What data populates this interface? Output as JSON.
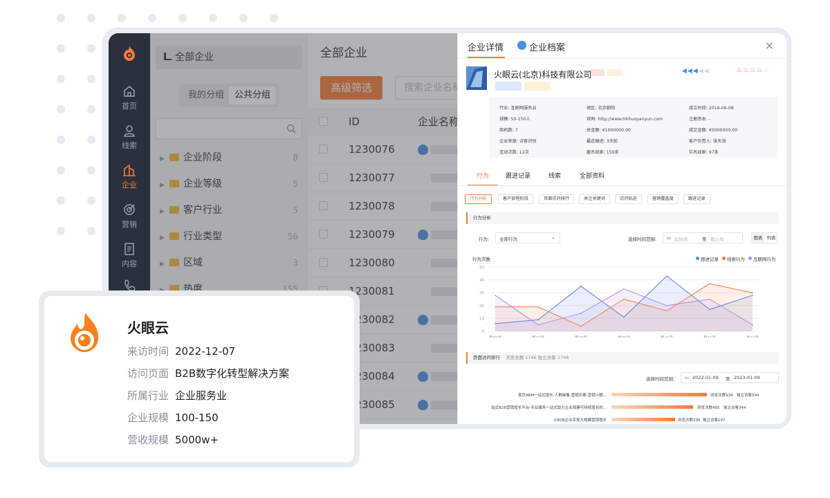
{
  "colors": {
    "accent": "#f37b3c",
    "rail": "#2b313c",
    "blue": "#5b7ee0",
    "purple": "#b08be8"
  },
  "rail": {
    "items": [
      {
        "label": "首页",
        "icon": "home-icon"
      },
      {
        "label": "线索",
        "icon": "user-icon"
      },
      {
        "label": "企业",
        "icon": "building-icon",
        "active": true
      },
      {
        "label": "营销",
        "icon": "target-icon"
      },
      {
        "label": "内容",
        "icon": "document-icon"
      },
      {
        "label": "",
        "icon": "phone-icon"
      }
    ]
  },
  "tree": {
    "header": "全部企业",
    "tabs": [
      "我的分组",
      "公共分组"
    ],
    "active_tab": "公共分组",
    "items": [
      {
        "label": "企业阶段",
        "count": "8"
      },
      {
        "label": "企业等级",
        "count": "5"
      },
      {
        "label": "客户行业",
        "count": "5"
      },
      {
        "label": "行业类型",
        "count": "56"
      },
      {
        "label": "区域",
        "count": "3"
      },
      {
        "label": "热度",
        "count": "155"
      }
    ]
  },
  "list": {
    "title": "全部企业",
    "filter_button": "高级筛选",
    "search_placeholder": "搜索企业名称",
    "columns": [
      "ID",
      "企业名称"
    ],
    "rows": [
      {
        "id": "1230076",
        "badge": true
      },
      {
        "id": "1230077",
        "badge": false
      },
      {
        "id": "1230078",
        "badge": false
      },
      {
        "id": "1230079",
        "badge": true
      },
      {
        "id": "1230080",
        "badge": false
      },
      {
        "id": "1230081",
        "badge": false
      },
      {
        "id": "1230082",
        "badge": true
      },
      {
        "id": "1230083",
        "badge": false
      },
      {
        "id": "1230084",
        "badge": true
      },
      {
        "id": "1230085",
        "badge": true
      }
    ]
  },
  "drawer": {
    "tabs": [
      "企业详情",
      "企业档案"
    ],
    "active_tab": "企业详情",
    "company_name": "火眼云(北京)科技有限公司",
    "info": [
      [
        "行业: 互联网服务业",
        "地区: 北京朝阳",
        "成立时间: 2016-06-08"
      ],
      [
        "规模: 50-150人",
        "官网: http://www.trkhuoyanyun.com",
        "注册资本: -"
      ],
      [
        "商机数: 7",
        "总金额: ¥1000000.00",
        "成交金额: ¥5000000.00"
      ],
      [
        "企业来源: 访客识别",
        "最近跟进: 3天前",
        "客户负责人: 张天海"
      ],
      [
        "互动次数: 12次",
        "匿名线索: 150条",
        "实名线索: 97条"
      ]
    ],
    "sub_tabs": [
      "行为",
      "跟进记录",
      "线索",
      "全部资料"
    ],
    "chips": [
      "行为分析",
      "客户旅程阶段",
      "页面访问排行",
      "关注关键词",
      "访问轨迹",
      "营销覆盖度",
      "跟进记录"
    ],
    "behavior_section": "行为分析",
    "behavior_label": "行为:",
    "behavior_select": "全部行为",
    "time_range_label": "选择时间范围:",
    "time_start_placeholder": "起始周",
    "time_to": "至",
    "time_end_placeholder": "截止周",
    "view_toggle": [
      "图表",
      "列表"
    ],
    "page_section_title": "页面访问排行",
    "page_section_stats": "浏览总数 1746   独立访客 1746",
    "date_label": "选择时间范围:",
    "date_start": "2022-01-09",
    "date_to": "至",
    "date_end": "2023-01-09",
    "rank": [
      {
        "page": "首页ABM一站式增长-人群画像-营销方案-营销火眼...",
        "views": "浏览次数934",
        "visitors": "独立访客594"
      },
      {
        "page": "站式B2B营销增长平台-专业服务一站式助力企业规建可持续增长的...",
        "views": "浏览次数495",
        "visitors": "独立访客344"
      },
      {
        "page": "以B2B企业实现大规模营销增长",
        "views": "浏览次数336",
        "visitors": "独立访客107"
      }
    ]
  },
  "chart_data": {
    "type": "line",
    "title": "行为次数",
    "x": [
      "第36周",
      "第37周",
      "第38周",
      "第39周",
      "第40周",
      "第41周",
      "第42周"
    ],
    "ylim": [
      0,
      50
    ],
    "yticks": [
      0,
      10,
      20,
      30,
      40,
      50
    ],
    "legend_position": "top-right",
    "series": [
      {
        "name": "跟进记录",
        "color": "#5b7ee0",
        "values": [
          6,
          9,
          35,
          11,
          43,
          17,
          28
        ]
      },
      {
        "name": "线索行为",
        "color": "#f37b3c",
        "values": [
          19,
          19,
          4,
          25,
          16,
          37,
          30
        ]
      },
      {
        "name": "互联网行为",
        "color": "#b08be8",
        "values": [
          28,
          5,
          14,
          33,
          20,
          25,
          5
        ]
      }
    ]
  },
  "card": {
    "title": "火眼云",
    "rows": [
      {
        "label": "来访时间",
        "value": "2022-12-07"
      },
      {
        "label": "访问页面",
        "value": "B2B数字化转型解决方案"
      },
      {
        "label": "所属行业",
        "value": "企业服务业"
      },
      {
        "label": "企业规模",
        "value": "100-150"
      },
      {
        "label": "营收规模",
        "value": "5000w+"
      }
    ]
  }
}
